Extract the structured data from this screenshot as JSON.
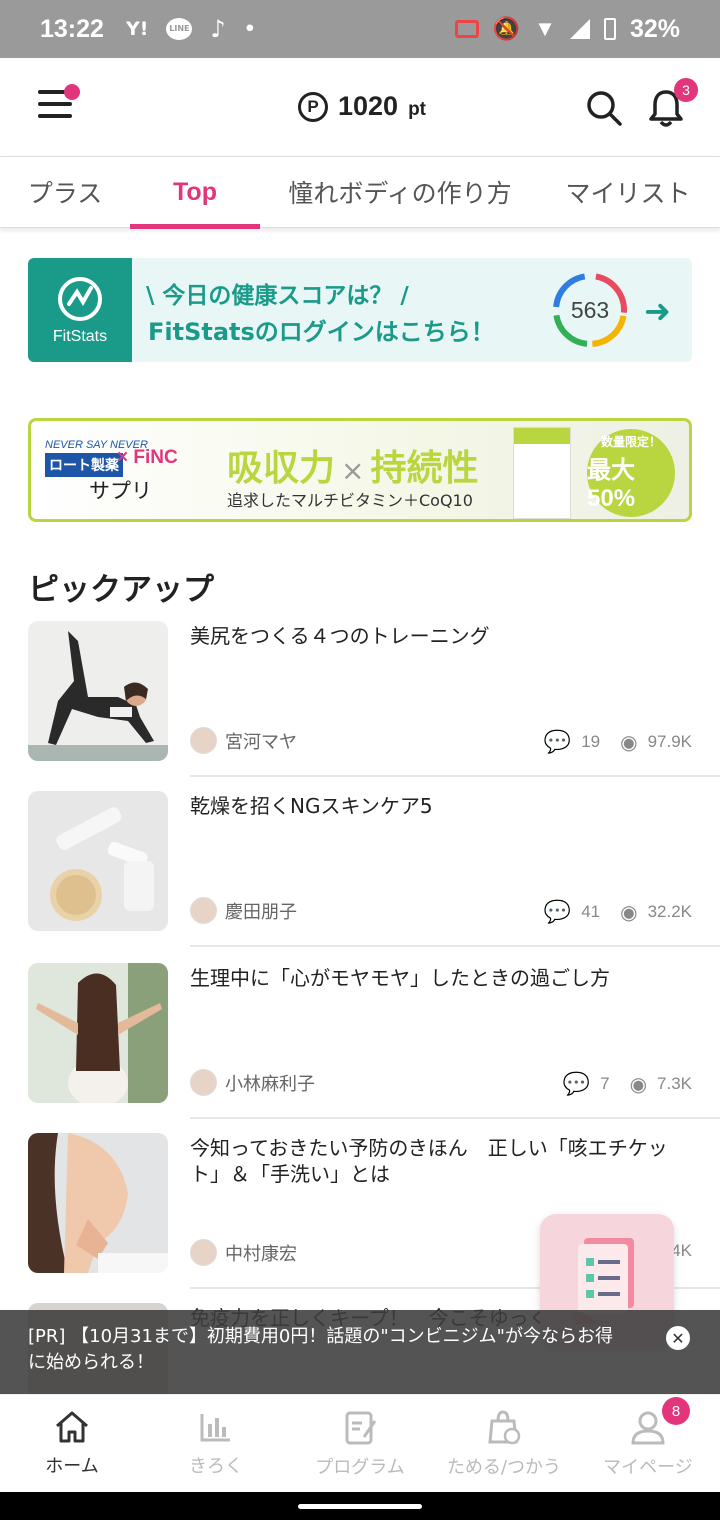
{
  "status_bar": {
    "time": "13:22",
    "app_icons": [
      "Y!",
      "LINE",
      "tiktok-icon",
      "•"
    ],
    "battery": "32%"
  },
  "header": {
    "points_symbol": "P",
    "points_value": "1020",
    "points_unit": "pt",
    "notification_count": "3"
  },
  "tabs": [
    {
      "label": "プラス",
      "active": false
    },
    {
      "label": "Top",
      "active": true
    },
    {
      "label": "憧れボディの作り方",
      "active": false
    },
    {
      "label": "マイリスト",
      "active": false
    }
  ],
  "fitstats_banner": {
    "logo_text": "FitStats",
    "line1": "\\ 今日の健康スコアは？ /",
    "line2": "FitStatsのログインはこちら！",
    "score": "563"
  },
  "ad_banner": {
    "brand_tagline": "NEVER SAY NEVER",
    "brand": "ロート製薬",
    "partner": "× FiNC",
    "product": "サプリ",
    "headline_a": "吸収力",
    "headline_x": "×",
    "headline_b": "持続性",
    "subline": "追求したマルチビタミン＋CoQ10",
    "offer_label": "数量限定！",
    "offer_value": "最大50%"
  },
  "pickup": {
    "title": "ピックアップ",
    "articles": [
      {
        "title": "美尻をつくる４つのトレーニング",
        "author": "宮河マヤ",
        "comments": "19",
        "views": "97.9K"
      },
      {
        "title": "乾燥を招くNGスキンケア5",
        "author": "慶田朋子",
        "comments": "41",
        "views": "32.2K"
      },
      {
        "title": "生理中に「心がモヤモヤ」したときの過ごし方",
        "author": "小林麻利子",
        "comments": "7",
        "views": "7.3K"
      },
      {
        "title": "今知っておきたい予防のきほん　正しい「咳エチケット」＆「手洗い」とは",
        "author": "中村康宏",
        "comments": "",
        "views": "4K"
      },
      {
        "title": "免疫力を正しくキープ！　今こそゆっくり"
      }
    ]
  },
  "pr_bar": {
    "text": "[PR] 【10月31まで】初期費用0円！話題の\"コンビニジム\"が今ならお得に始められる！"
  },
  "bottom_nav": [
    {
      "label": "ホーム",
      "active": true
    },
    {
      "label": "きろく",
      "active": false
    },
    {
      "label": "プログラム",
      "active": false
    },
    {
      "label": "ためる/つかう",
      "active": false
    },
    {
      "label": "マイページ",
      "active": false,
      "badge": "8"
    }
  ],
  "colors": {
    "accent": "#e2357b",
    "fitstats": "#1a9b8a",
    "ad_green": "#b9d640"
  }
}
